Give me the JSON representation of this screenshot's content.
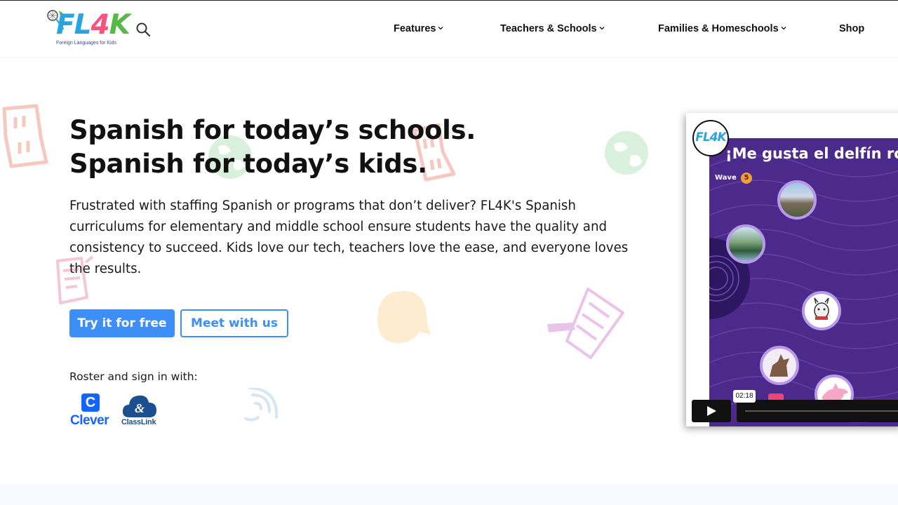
{
  "brand": {
    "logo_letters": [
      "FL",
      "4",
      "K"
    ],
    "tagline": "Foreign Languages for Kids"
  },
  "nav": {
    "items": [
      {
        "label": "Features",
        "has_dropdown": true
      },
      {
        "label": "Teachers & Schools",
        "has_dropdown": true
      },
      {
        "label": "Families & Homeschools",
        "has_dropdown": true
      },
      {
        "label": "Shop",
        "has_dropdown": false
      }
    ],
    "search_icon": "search-icon"
  },
  "hero": {
    "headline_line1": "Spanish for today’s schools.",
    "headline_line2": "Spanish for today’s kids.",
    "description": "Frustrated with staffing Spanish or programs that don’t deliver? FL4K's Spanish curriculums for elementary and middle school ensure students have the quality and consistency to succeed. Kids love our tech, teachers love the ease, and everyone loves the results.",
    "primary_button": "Try it for free",
    "secondary_button": "Meet with us",
    "roster_label": "Roster and sign in with:",
    "clever_letter": "C",
    "clever_label": "Clever",
    "classlink_label": "ClassLink"
  },
  "video": {
    "logo_text": "FL4K",
    "title": "¡Me gusta el delfín ro",
    "wave_label": "Wave",
    "wave_number": "5",
    "timestamp": "02:18"
  },
  "colors": {
    "accent": "#3e8ef7",
    "clever_blue": "#1464ff",
    "classlink_blue": "#1b4f8f",
    "video_bg": "#4b2a8c"
  }
}
